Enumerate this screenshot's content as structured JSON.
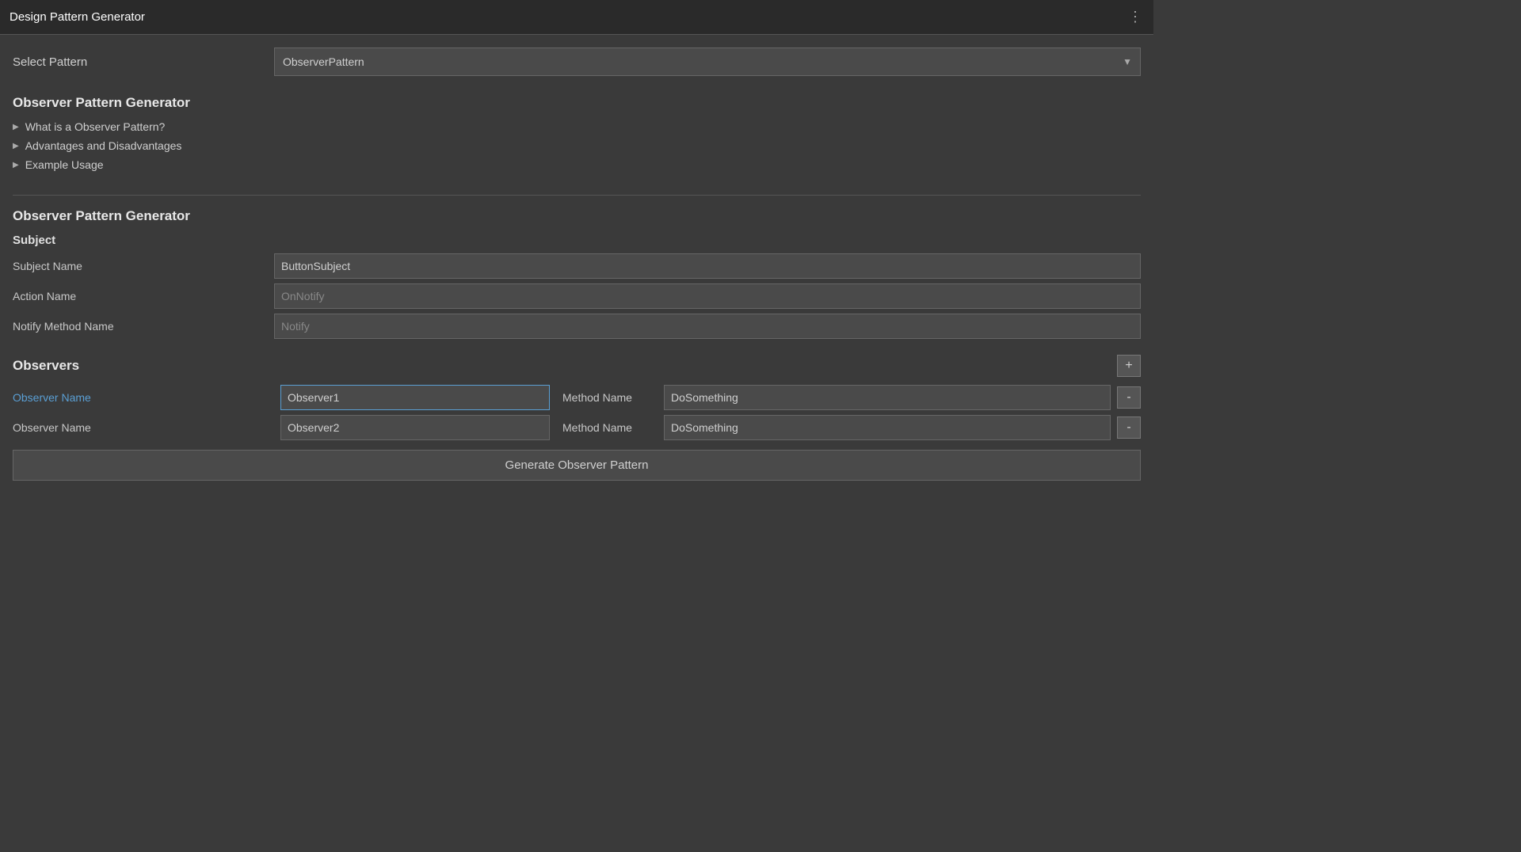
{
  "titleBar": {
    "title": "Design Pattern Generator",
    "menuIcon": "⋮"
  },
  "selectPattern": {
    "label": "Select Pattern",
    "value": "ObserverPattern",
    "dropdownArrow": "▼"
  },
  "infoSection": {
    "heading": "Observer Pattern Generator",
    "items": [
      {
        "label": "What is a Observer Pattern?"
      },
      {
        "label": "Advantages and Disadvantages"
      },
      {
        "label": "Example Usage"
      }
    ],
    "arrow": "▶"
  },
  "formSection": {
    "heading": "Observer Pattern Generator",
    "subheading": "Subject",
    "fields": [
      {
        "label": "Subject Name",
        "value": "ButtonSubject",
        "placeholder": "ButtonSubject"
      },
      {
        "label": "Action Name",
        "value": "OnNotify",
        "placeholder": "OnNotify"
      },
      {
        "label": "Notify Method Name",
        "value": "Notify",
        "placeholder": "Notify"
      }
    ]
  },
  "observers": {
    "heading": "Observers",
    "addButton": "+",
    "rows": [
      {
        "nameLabel": "Observer Name",
        "nameValue": "Observer1",
        "namePlaceholder": "Observer1",
        "methodLabel": "Method Name",
        "methodValue": "DoSomething",
        "methodPlaceholder": "DoSomething",
        "highlighted": true
      },
      {
        "nameLabel": "Observer Name",
        "nameValue": "Observer2",
        "namePlaceholder": "Observer2",
        "methodLabel": "Method Name",
        "methodValue": "DoSomething",
        "methodPlaceholder": "DoSomething",
        "highlighted": false
      }
    ],
    "removeButton": "-"
  },
  "generateButton": {
    "label": "Generate Observer Pattern"
  }
}
